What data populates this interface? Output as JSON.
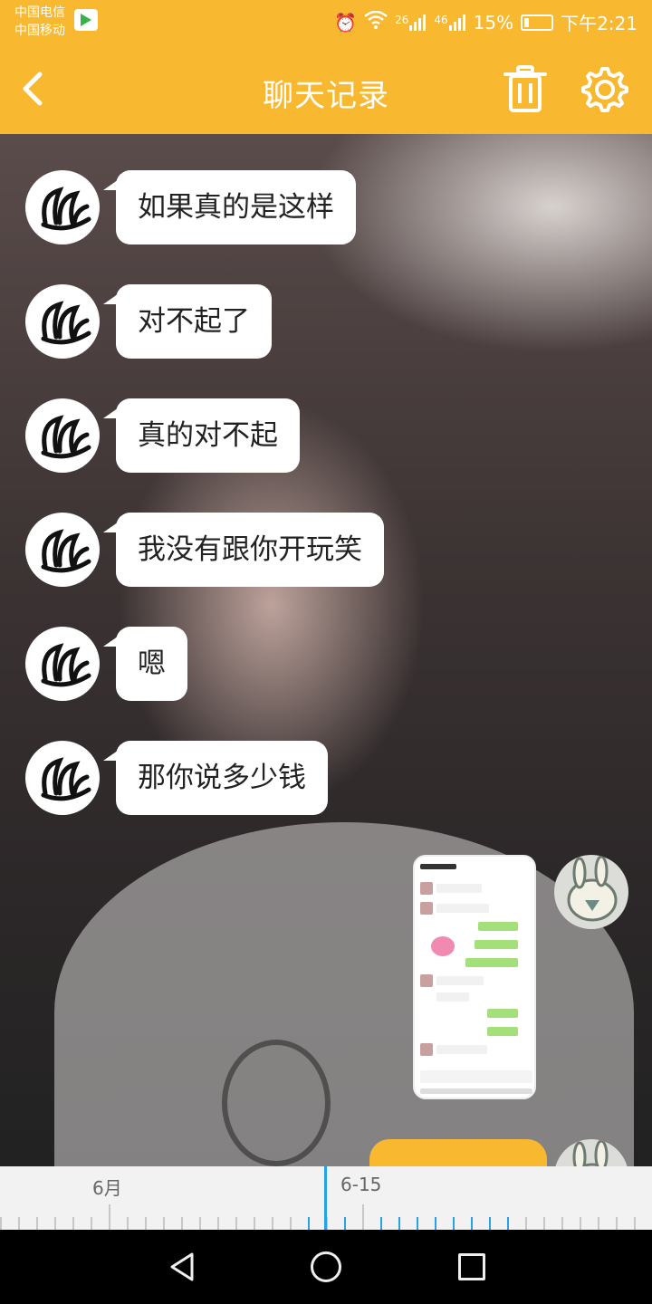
{
  "status_bar": {
    "carrier_1": "中国电信",
    "carrier_2": "中国移动",
    "battery": "15%",
    "time": "下午2:21",
    "network_1": "26",
    "network_2": "46"
  },
  "header": {
    "title": "聊天记录"
  },
  "messages": [
    {
      "text": "如果真的是这样"
    },
    {
      "text": "对不起了"
    },
    {
      "text": "真的对不起"
    },
    {
      "text": "我没有跟你开玩笑"
    },
    {
      "text": "嗯"
    },
    {
      "text": "那你说多少钱"
    }
  ],
  "timeline": {
    "month_label": "6月",
    "date_label": "6-15"
  },
  "colors": {
    "accent": "#f8b82f",
    "timeline_highlight": "#26a3e8"
  }
}
